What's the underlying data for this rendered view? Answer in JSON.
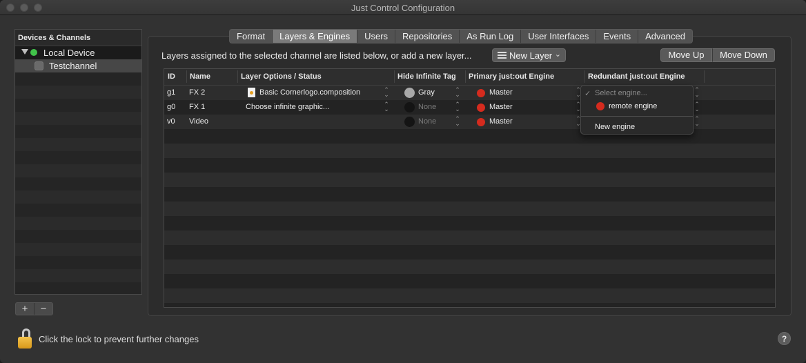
{
  "window": {
    "title": "Just Control Configuration"
  },
  "sidebar": {
    "header": "Devices & Channels",
    "device": {
      "label": "Local Device",
      "status_color": "#41c34a"
    },
    "channel": {
      "label": "Testchannel"
    },
    "add_label": "+",
    "remove_label": "−"
  },
  "tabs": [
    {
      "label": "Format",
      "active": false
    },
    {
      "label": "Layers & Engines",
      "active": true
    },
    {
      "label": "Users",
      "active": false
    },
    {
      "label": "Repositories",
      "active": false
    },
    {
      "label": "As Run Log",
      "active": false
    },
    {
      "label": "User Interfaces",
      "active": false
    },
    {
      "label": "Events",
      "active": false
    },
    {
      "label": "Advanced",
      "active": false
    }
  ],
  "toolbar": {
    "info": "Layers assigned to the selected channel are listed below, or add a new layer...",
    "new_layer_label": "New Layer",
    "move_up_label": "Move Up",
    "move_down_label": "Move Down"
  },
  "table": {
    "headers": [
      "ID",
      "Name",
      "Layer Options / Status",
      "Hide Infinite Tag",
      "Primary just:out Engine",
      "Redundant just:out Engine"
    ],
    "rows": [
      {
        "id": "g1",
        "name": "FX 2",
        "options": "Basic Cornerlogo.composition",
        "tag": "Gray",
        "primary": "Master"
      },
      {
        "id": "g0",
        "name": "FX 1",
        "options": "Choose infinite graphic...",
        "tag": "None",
        "primary": "Master"
      },
      {
        "id": "v0",
        "name": "Video",
        "options": "",
        "tag": "None",
        "primary": "Master"
      }
    ]
  },
  "engine_menu": {
    "placeholder": "Select engine...",
    "items": [
      "remote engine"
    ],
    "new_engine_label": "New engine",
    "checkmark": "✓"
  },
  "footer": {
    "lock_text": "Click the lock to prevent further changes",
    "help_label": "?"
  },
  "colors": {
    "status_red": "#d52b1e",
    "status_green": "#41c34a",
    "tag_gray": "#a9a9a9"
  }
}
